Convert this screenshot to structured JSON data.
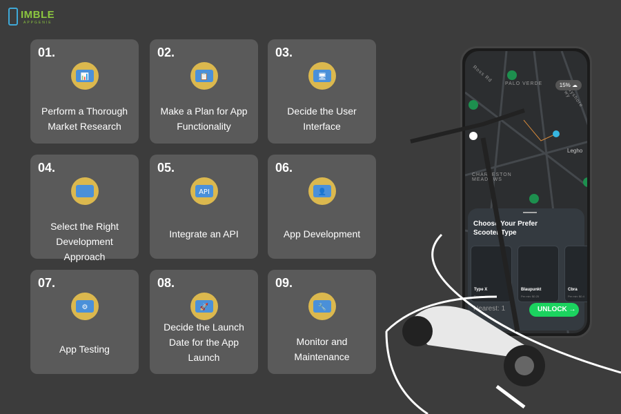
{
  "logo": {
    "name": "IMBLE",
    "sub": "APPGENIE",
    "letter": "N"
  },
  "steps": [
    {
      "num": "01.",
      "label": "Perform a Thorough Market Research",
      "icon": "market-research-icon"
    },
    {
      "num": "02.",
      "label": "Make a Plan for App Functionality",
      "icon": "plan-icon"
    },
    {
      "num": "03.",
      "label": "Decide the User Interface",
      "icon": "user-interface-icon"
    },
    {
      "num": "04.",
      "label": "Select the Right Development Approach",
      "icon": "code-approach-icon"
    },
    {
      "num": "05.",
      "label": "Integrate an API",
      "icon": "api-icon"
    },
    {
      "num": "06.",
      "label": "App Development",
      "icon": "developer-icon"
    },
    {
      "num": "07.",
      "label": "App Testing",
      "icon": "testing-icon"
    },
    {
      "num": "08.",
      "label": "Decide the Launch Date for the App Launch",
      "icon": "rocket-launch-icon"
    },
    {
      "num": "09.",
      "label": "Monitor and Maintenance",
      "icon": "maintenance-tools-icon"
    }
  ],
  "phone": {
    "weather": "15%",
    "map_labels": [
      "Ross Rd",
      "PALO VERDE",
      "Bayshore Fwy",
      "Legho",
      "CHARLESTON MEADOWS"
    ],
    "sheet_title": "Choose Your Prefer Scooter Type",
    "scooters": [
      {
        "name": "Type X",
        "price": "Per min: $0.30"
      },
      {
        "name": "Blaupunkt",
        "price": "Per min: $0.25"
      },
      {
        "name": "Cbra",
        "price": "Per min: $0.4"
      }
    ],
    "nearest": "Nearest: 1",
    "unlock": "UNLOCK →"
  },
  "colors": {
    "background": "#3c3c3c",
    "card": "#5a5a5a",
    "accent": "#1bd35f",
    "logo": "#8cc63f"
  }
}
